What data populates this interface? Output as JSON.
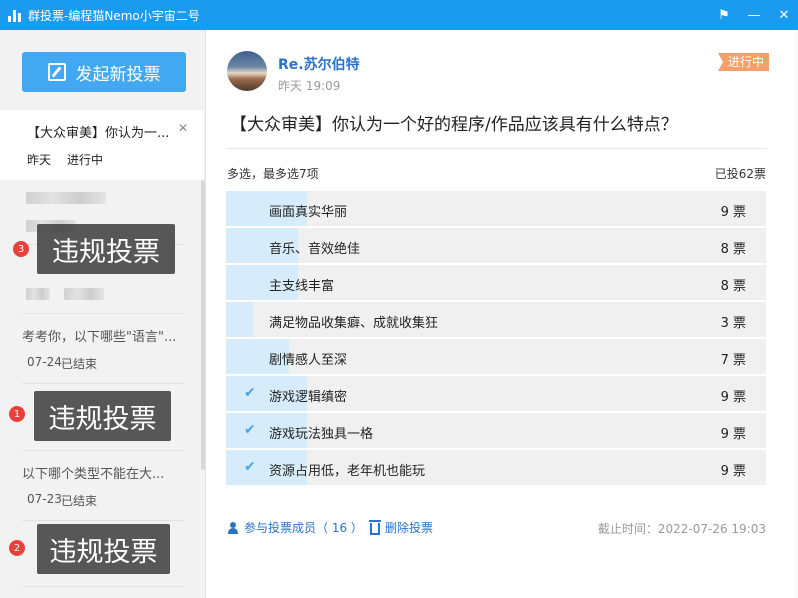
{
  "window": {
    "title": "群投票-编程猫Nemo小宇宙二号",
    "controls": [
      "flag",
      "minimize",
      "close"
    ]
  },
  "sidebar": {
    "new_vote_label": "发起新投票",
    "active_item": {
      "title": "【大众审美】你认为一...",
      "date": "昨天",
      "status": "进行中"
    },
    "items": [
      {
        "title": "考考你，以下哪些\"语言\"...",
        "date": "07-24",
        "status": "已结束"
      },
      {
        "title": "以下哪个类型不能在大...",
        "date": "07-23",
        "status": "已结束"
      }
    ],
    "violations": [
      {
        "badge": "3",
        "label": "违规投票"
      },
      {
        "badge": "1",
        "label": "违规投票"
      },
      {
        "badge": "2",
        "label": "违规投票"
      }
    ]
  },
  "post": {
    "author": "Re.苏尔伯特",
    "time": "昨天 19:09",
    "status": "进行中",
    "question": "【大众审美】你认为一个好的程序/作品应该具有什么特点？",
    "mode": "多选，最多选7项",
    "total": "已投62票",
    "options": [
      {
        "label": "画面真实华丽",
        "count": "9 票",
        "checked": false,
        "share": 0.145
      },
      {
        "label": "音乐、音效绝佳",
        "count": "8 票",
        "checked": false,
        "share": 0.129
      },
      {
        "label": "主支线丰富",
        "count": "8 票",
        "checked": false,
        "share": 0.129
      },
      {
        "label": "满足物品收集癖、成就收集狂",
        "count": "3 票",
        "checked": false,
        "share": 0.048
      },
      {
        "label": "剧情感人至深",
        "count": "7 票",
        "checked": false,
        "share": 0.113
      },
      {
        "label": "游戏逻辑缜密",
        "count": "9 票",
        "checked": true,
        "share": 0.145
      },
      {
        "label": "游戏玩法独具一格",
        "count": "9 票",
        "checked": true,
        "share": 0.145
      },
      {
        "label": "资源占用低，老年机也能玩",
        "count": "9 票",
        "checked": true,
        "share": 0.145
      }
    ],
    "members_link": "参与投票成员（ 16 ）",
    "delete_link": "删除投票",
    "deadline": "截止时间：2022-07-26 19:03"
  },
  "colors": {
    "titlebar": "#1a9bf0",
    "accent": "#42a8f1",
    "link": "#2a73c7",
    "bar_fill": "#d6ecfa",
    "status_tag": "#f5a06a",
    "badge": "#e8413b"
  }
}
